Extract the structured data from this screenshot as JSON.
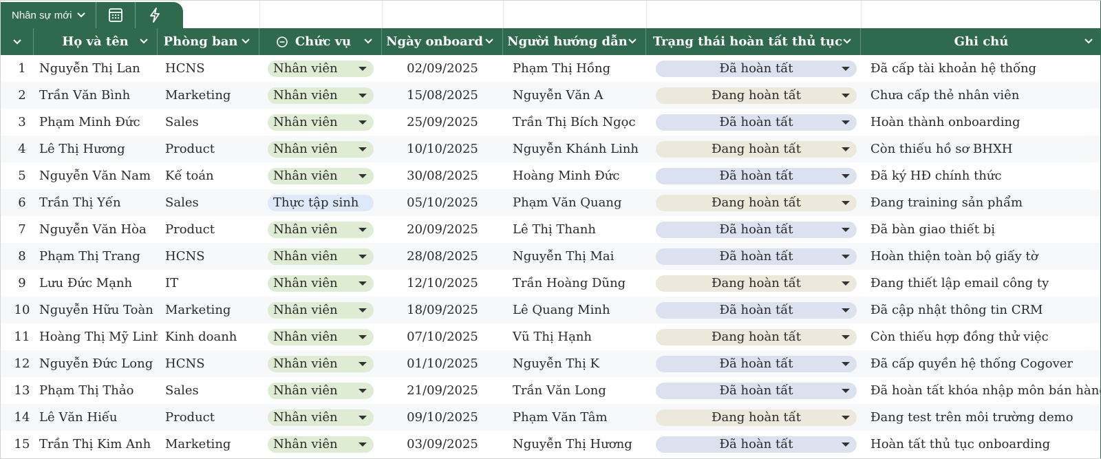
{
  "sheet_tab": {
    "name": "Nhân sự mới"
  },
  "colors": {
    "header_bg": "#2f6a4f",
    "role_pill": "#dfecd4",
    "intern_pill": "#dde9f8",
    "status_done": "#dbe1ee",
    "status_progress": "#ede8dc"
  },
  "columns": {
    "name": "Họ và tên",
    "dept": "Phòng ban",
    "role": "Chức vụ",
    "date": "Ngày onboard",
    "mentor": "Người hướng dẫn",
    "status": "Trạng thái hoàn tất thủ tục",
    "note": "Ghi chú"
  },
  "rows": [
    {
      "idx": "1",
      "name": "Nguyễn Thị Lan",
      "dept": "HCNS",
      "role": "Nhân viên",
      "date": "02/09/2025",
      "mentor": "Phạm Thị Hồng",
      "status": "Đã hoàn tất",
      "note": "Đã cấp tài khoản hệ thống"
    },
    {
      "idx": "2",
      "name": "Trần Văn Bình",
      "dept": "Marketing",
      "role": "Nhân viên",
      "date": "15/08/2025",
      "mentor": "Nguyễn Văn A",
      "status": "Đang hoàn tất",
      "note": "Chưa cấp thẻ nhân viên"
    },
    {
      "idx": "3",
      "name": "Phạm Minh Đức",
      "dept": "Sales",
      "role": "Nhân viên",
      "date": "25/09/2025",
      "mentor": "Trần Thị Bích Ngọc",
      "status": "Đã hoàn tất",
      "note": "Hoàn thành onboarding"
    },
    {
      "idx": "4",
      "name": "Lê Thị Hương",
      "dept": "Product",
      "role": "Nhân viên",
      "date": "10/10/2025",
      "mentor": "Nguyễn Khánh Linh",
      "status": "Đang hoàn tất",
      "note": "Còn thiếu hồ sơ BHXH"
    },
    {
      "idx": "5",
      "name": "Nguyễn Văn Nam",
      "dept": "Kế toán",
      "role": "Nhân viên",
      "date": "30/08/2025",
      "mentor": "Hoàng Minh Đức",
      "status": "Đã hoàn tất",
      "note": "Đã ký HĐ chính thức"
    },
    {
      "idx": "6",
      "name": "Trần Thị Yến",
      "dept": "Sales",
      "role": "Thực tập sinh",
      "date": "05/10/2025",
      "mentor": "Phạm Văn Quang",
      "status": "Đang hoàn tất",
      "note": "Đang training sản phẩm"
    },
    {
      "idx": "7",
      "name": "Nguyễn Văn Hòa",
      "dept": "Product",
      "role": "Nhân viên",
      "date": "20/09/2025",
      "mentor": "Lê Thị Thanh",
      "status": "Đã hoàn tất",
      "note": "Đã bàn giao thiết bị"
    },
    {
      "idx": "8",
      "name": "Phạm Thị Trang",
      "dept": "HCNS",
      "role": "Nhân viên",
      "date": "28/08/2025",
      "mentor": "Nguyễn Thị Mai",
      "status": "Đã hoàn tất",
      "note": "Hoàn thiện toàn bộ giấy tờ"
    },
    {
      "idx": "9",
      "name": "Lưu Đức Mạnh",
      "dept": "IT",
      "role": "Nhân viên",
      "date": "12/10/2025",
      "mentor": "Trần Hoàng Dũng",
      "status": "Đang hoàn tất",
      "note": "Đang thiết lập email công ty"
    },
    {
      "idx": "10",
      "name": "Nguyễn Hữu Toàn",
      "dept": "Marketing",
      "role": "Nhân viên",
      "date": "18/09/2025",
      "mentor": "Lê Quang Minh",
      "status": "Đã hoàn tất",
      "note": "Đã cập nhật thông tin CRM"
    },
    {
      "idx": "11",
      "name": "Hoàng Thị Mỹ Linh",
      "dept": "Kinh doanh",
      "role": "Nhân viên",
      "date": "07/10/2025",
      "mentor": "Vũ Thị Hạnh",
      "status": "Đang hoàn tất",
      "note": "Còn thiếu hợp đồng thử việc"
    },
    {
      "idx": "12",
      "name": "Nguyễn Đức Long",
      "dept": "HCNS",
      "role": "Nhân viên",
      "date": "01/10/2025",
      "mentor": "Nguyễn Thị K",
      "status": "Đã hoàn tất",
      "note": "Đã cấp quyền hệ thống Cogover"
    },
    {
      "idx": "13",
      "name": "Phạm Thị Thảo",
      "dept": "Sales",
      "role": "Nhân viên",
      "date": "21/09/2025",
      "mentor": "Trần Văn Long",
      "status": "Đã hoàn tất",
      "note": "Đã hoàn tất khóa nhập môn bán hàng"
    },
    {
      "idx": "14",
      "name": "Lê Văn Hiếu",
      "dept": "Product",
      "role": "Nhân viên",
      "date": "09/10/2025",
      "mentor": "Phạm Văn Tâm",
      "status": "Đang hoàn tất",
      "note": "Đang test trên môi trường demo"
    },
    {
      "idx": "15",
      "name": "Trần Thị Kim Anh",
      "dept": "Marketing",
      "role": "Nhân viên",
      "date": "03/09/2025",
      "mentor": "Nguyễn Thị Hương",
      "status": "Đã hoàn tất",
      "note": "Hoàn tất thủ tục onboarding"
    }
  ]
}
